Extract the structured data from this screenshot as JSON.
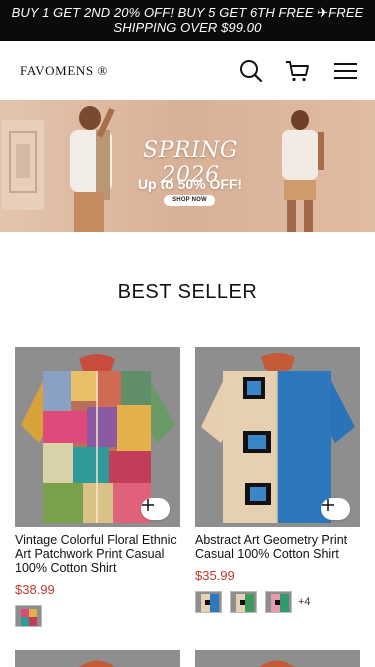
{
  "promo": {
    "text": "BUY 1 GET 2ND 20% OFF! BUY 5 GET 6TH FREE ✈FREE SHIPPING OVER $99.00"
  },
  "header": {
    "logo": "FAVOMENS ®",
    "icons": [
      "search-icon",
      "cart-icon",
      "hamburger-menu-icon"
    ]
  },
  "hero": {
    "headline": "SPRING 2026",
    "subline": "Up to 50% OFF!",
    "cta": "SHOP NOW"
  },
  "section": {
    "title": "BEST SELLER"
  },
  "products": [
    {
      "name": "Vintage Colorful Floral Ethnic Art Patchwork Print Casual 100% Cotton Shirt",
      "price": "$38.99",
      "swatch_count_extra": ""
    },
    {
      "name": "Abstract Art Geometry Print Casual 100% Cotton Shirt",
      "price": "$35.99",
      "swatch_count_extra": "+4"
    }
  ],
  "colors": {
    "promo_bg": "#0b0b0b",
    "price": "#c0392b",
    "image_bg": "#8f8f8f"
  }
}
